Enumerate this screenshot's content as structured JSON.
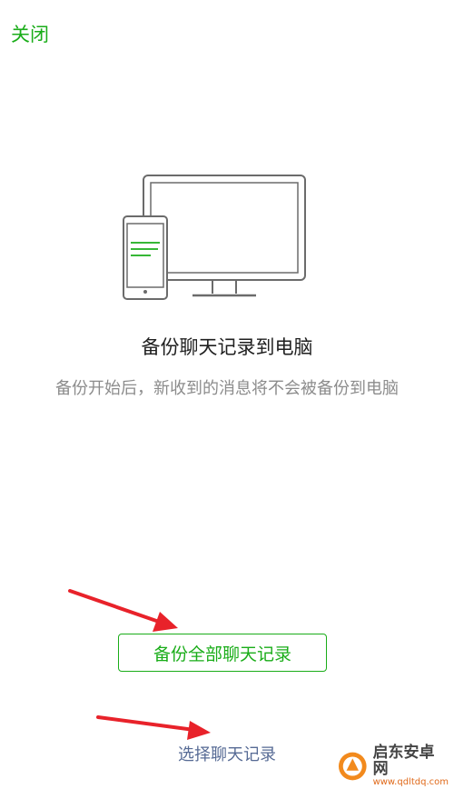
{
  "header": {
    "close_label": "关闭"
  },
  "main": {
    "title": "备份聊天记录到电脑",
    "subtitle": "备份开始后，新收到的消息将不会被备份到电脑",
    "backup_all_label": "备份全部聊天记录",
    "select_label": "选择聊天记录"
  },
  "watermark": {
    "name": "启东安卓网",
    "url": "www.qdltdq.com"
  },
  "colors": {
    "accent": "#1aad19",
    "link": "#576b95",
    "arrow": "#e8222a"
  }
}
